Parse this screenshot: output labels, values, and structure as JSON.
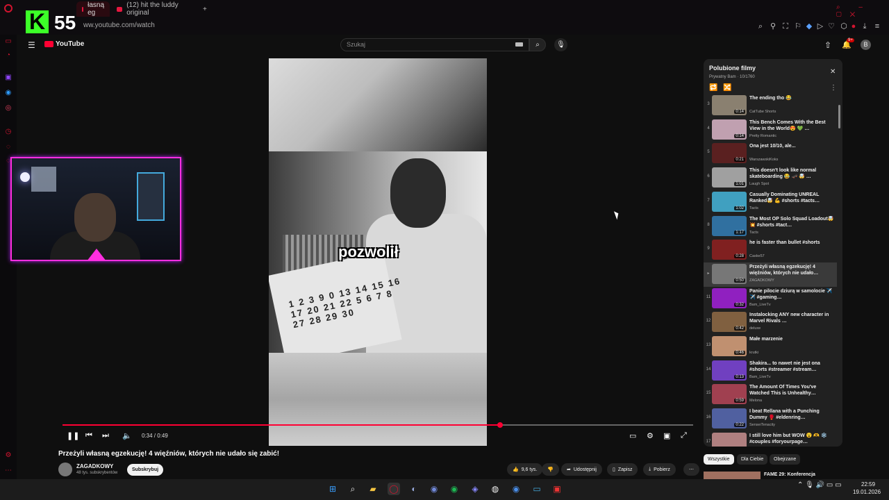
{
  "browser": {
    "tabs": [
      {
        "label": "łasną eg",
        "active": true
      },
      {
        "label": "(12) hit the luddy original",
        "active": false
      }
    ],
    "new_tab": "+",
    "url": "ww.youtube.com/watch"
  },
  "overlay": {
    "logo_letter": "K",
    "number": "55"
  },
  "youtube": {
    "logo_text": "YouTube",
    "search_placeholder": "Szukaj",
    "notif_badge": "9+",
    "avatar_letter": "B"
  },
  "video": {
    "caption": "pozwolił",
    "newspaper_text": "1 2 3 9 0 13 14 15 16 17 20 21 22 5 6 7 8 27 28 29 30",
    "time": "0:34 / 0:49",
    "progress_fraction": 0.694
  },
  "meta": {
    "title": "Przeżyli własną egzekucję! 4 więźniów, których nie udało się zabić!",
    "channel": "ZAGADKOWY",
    "subs": "48 tys. subskrybentów",
    "subscribe": "Subskrybuj",
    "likes": "9,6 tys.",
    "share": "Udostępnij",
    "save": "Zapisz",
    "download": "Pobierz",
    "more": "⋯"
  },
  "playlist": {
    "title": "Polubione filmy",
    "subtitle": "Prywatny Bam · 10/1760",
    "items": [
      {
        "idx": "3",
        "title": "The ending tho 😂",
        "channel": "CatTube Shorts",
        "dur": "0:14",
        "color": "#8a8070"
      },
      {
        "idx": "4",
        "title": "This Bench Comes With the Best View in the World😍 💚 …",
        "channel": "Pretty Romantic",
        "dur": "0:14",
        "color": "#c0a0b0"
      },
      {
        "idx": "5",
        "title": "Ona jest 10/10, ale...",
        "channel": "WarszawskiKoks",
        "dur": "0:21",
        "color": "#5a2020"
      },
      {
        "idx": "6",
        "title": "This doesn't look like normal skateboarding 😂 🛹 🤯 …",
        "channel": "Laugh Spot",
        "dur": "1:01",
        "color": "#a0a0a0"
      },
      {
        "idx": "7",
        "title": "Casually Dominating UNREAL Ranked🤯 💪 #shorts #tacts…",
        "channel": "Tacts",
        "dur": "1:02",
        "color": "#40a0c0"
      },
      {
        "idx": "8",
        "title": "The Most OP Solo Squad Loadout🤯 💥 #shorts #tact…",
        "channel": "Tacts",
        "dur": "1:17",
        "color": "#3070a0"
      },
      {
        "idx": "9",
        "title": "he is faster than bullet #shorts",
        "channel": "Caske57",
        "dur": "0:28",
        "color": "#802020"
      },
      {
        "idx": "▸",
        "title": "Przeżyli własną egzekucję! 4 więźniów, których nie udało…",
        "channel": "ZAGADKOWY",
        "dur": "0:50",
        "color": "#777777"
      },
      {
        "idx": "11",
        "title": "Panie pilocie dziurą w samolocie ✈️ ✈️ #gaming…",
        "channel": "Bam_LiveTv",
        "dur": "0:32",
        "color": "#9020c0"
      },
      {
        "idx": "12",
        "title": "Instalocking ANY new character in Marvel Rivals …",
        "channel": "deluxe",
        "dur": "0:42",
        "color": "#806040"
      },
      {
        "idx": "13",
        "title": "Małe marzenie",
        "channel": "krutki",
        "dur": "0:46",
        "color": "#c09070"
      },
      {
        "idx": "14",
        "title": "Shakira... to nawet nie jest ona #shorts #streamer #stream…",
        "channel": "Bam_LiveTv",
        "dur": "0:13",
        "color": "#7040c0"
      },
      {
        "idx": "15",
        "title": "The Amount Of Times You've Watched This is Unhealthy…",
        "channel": "Melona",
        "dur": "0:59",
        "color": "#a04050"
      },
      {
        "idx": "16",
        "title": "I beat Rellana with a Punching Dummy 🥊 #eldenring…",
        "channel": "SenseiTenacity",
        "dur": "0:22",
        "color": "#5060a0"
      },
      {
        "idx": "17",
        "title": "I still love him but WOW 😮 🫶 ❄️ #couples #foryourpage…",
        "channel": "Thompson Vibes",
        "dur": "0:36",
        "color": "#b08080"
      }
    ]
  },
  "chips": [
    "Wszystkie",
    "Dla Ciebie",
    "Obejrzane"
  ],
  "next_video": "FAME 29: Konferencja",
  "clock": {
    "time": "22:59",
    "date": "19.01.2026"
  }
}
